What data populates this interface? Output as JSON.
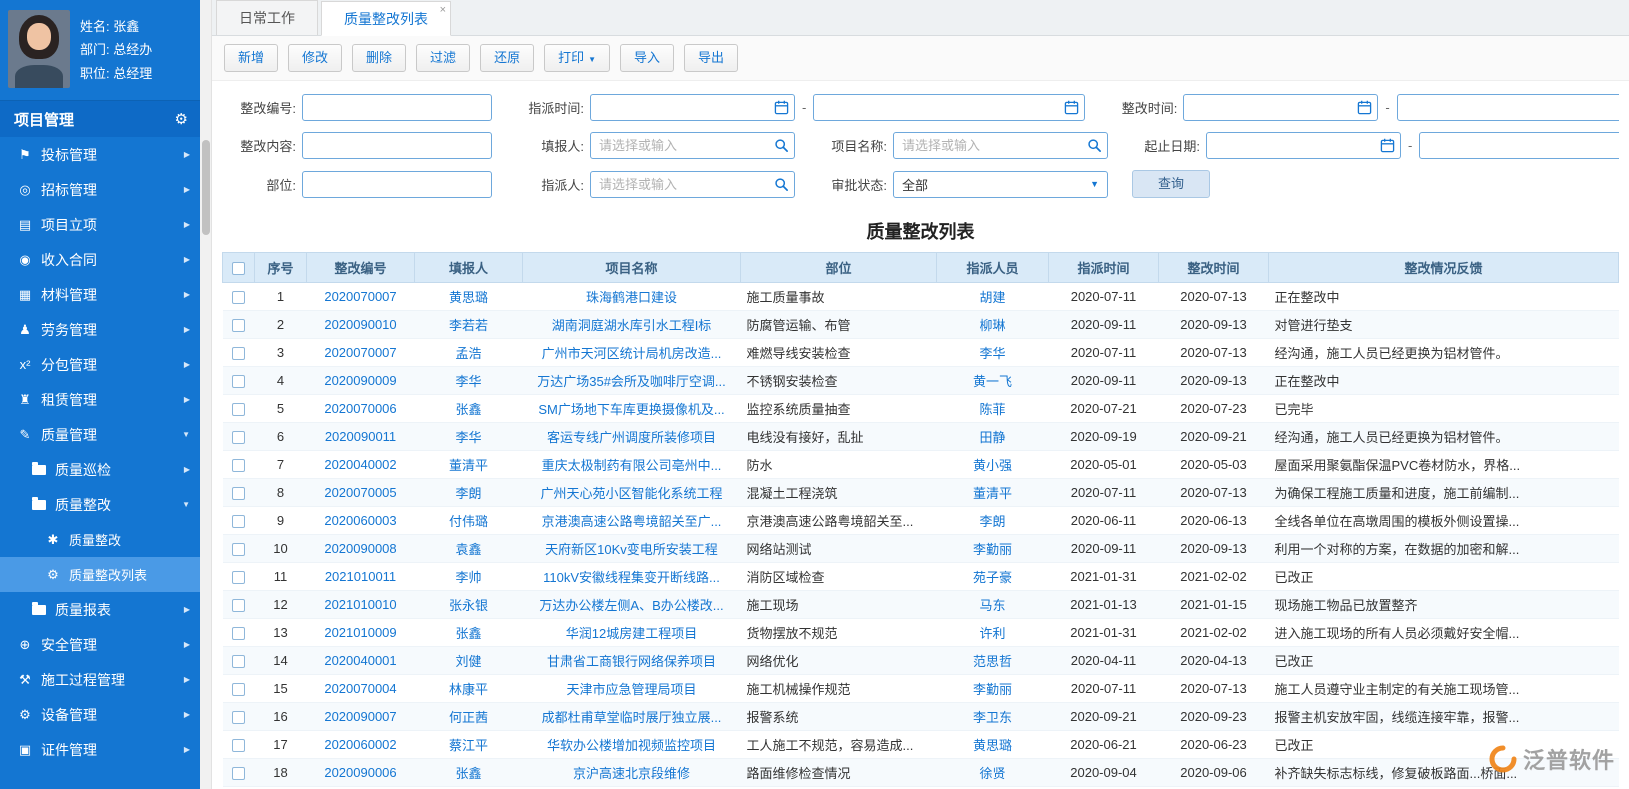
{
  "profile": {
    "name": "姓名: 张鑫",
    "department": "部门: 总经办",
    "position": "职位: 总经理"
  },
  "sidebar": {
    "header": "项目管理",
    "items": [
      {
        "label": "投标管理",
        "icon": "bid-management-icon",
        "glyph": "⚑",
        "arrow": "right",
        "level": 0
      },
      {
        "label": "招标管理",
        "icon": "tender-management-icon",
        "glyph": "◎",
        "arrow": "right",
        "level": 0
      },
      {
        "label": "项目立项",
        "icon": "project-initiation-icon",
        "glyph": "▤",
        "arrow": "right",
        "level": 0
      },
      {
        "label": "收入合同",
        "icon": "income-contract-icon",
        "glyph": "◉",
        "arrow": "right",
        "level": 0
      },
      {
        "label": "材料管理",
        "icon": "material-management-icon",
        "glyph": "▦",
        "arrow": "right",
        "level": 0
      },
      {
        "label": "劳务管理",
        "icon": "labor-management-icon",
        "glyph": "♟",
        "arrow": "right",
        "level": 0
      },
      {
        "label": "分包管理",
        "icon": "subcontract-management-icon",
        "glyph": "x²",
        "arrow": "right",
        "level": 0
      },
      {
        "label": "租赁管理",
        "icon": "lease-management-icon",
        "glyph": "♜",
        "arrow": "right",
        "level": 0
      },
      {
        "label": "质量管理",
        "icon": "quality-management-icon",
        "glyph": "✎",
        "arrow": "down",
        "level": 0
      },
      {
        "label": "质量巡检",
        "icon": "folder-icon",
        "glyph": "folder",
        "arrow": "right",
        "level": 1
      },
      {
        "label": "质量整改",
        "icon": "folder-icon",
        "glyph": "folder",
        "arrow": "down",
        "level": 1
      },
      {
        "label": "质量整改",
        "icon": "asterisk-icon",
        "glyph": "✱",
        "arrow": "none",
        "level": 2,
        "active": false
      },
      {
        "label": "质量整改列表",
        "icon": "gears-icon",
        "glyph": "⚙",
        "arrow": "none",
        "level": 2,
        "active": true
      },
      {
        "label": "质量报表",
        "icon": "folder-icon",
        "glyph": "folder",
        "arrow": "right",
        "level": 1
      },
      {
        "label": "安全管理",
        "icon": "safety-management-icon",
        "glyph": "⊕",
        "arrow": "right",
        "level": 0
      },
      {
        "label": "施工过程管理",
        "icon": "construction-process-icon",
        "glyph": "⚒",
        "arrow": "right",
        "level": 0
      },
      {
        "label": "设备管理",
        "icon": "equipment-management-icon",
        "glyph": "⚙",
        "arrow": "right",
        "level": 0
      },
      {
        "label": "证件管理",
        "icon": "certificate-management-icon",
        "glyph": "▣",
        "arrow": "right",
        "level": 0
      }
    ]
  },
  "tabs": [
    {
      "label": "日常工作",
      "active": false,
      "closable": false
    },
    {
      "label": "质量整改列表",
      "active": true,
      "closable": true
    }
  ],
  "toolbar": [
    {
      "label": "新增",
      "name": "add-button"
    },
    {
      "label": "修改",
      "name": "modify-button"
    },
    {
      "label": "删除",
      "name": "delete-button"
    },
    {
      "label": "过滤",
      "name": "filter-button"
    },
    {
      "label": "还原",
      "name": "restore-button"
    },
    {
      "label": "打印",
      "name": "print-button",
      "caret": true
    },
    {
      "label": "导入",
      "name": "import-button"
    },
    {
      "label": "导出",
      "name": "export-button"
    }
  ],
  "filters": {
    "rows": [
      [
        {
          "type": "text",
          "label": "整改编号:",
          "name": "rectify-no-input"
        },
        {
          "type": "daterange",
          "label": "指派时间:",
          "from": "assign-time-from",
          "to": "assign-time-to"
        },
        {
          "type": "daterange",
          "label": "整改时间:",
          "from": "rectify-time-from",
          "to": "rectify-time-to"
        }
      ],
      [
        {
          "type": "text",
          "label": "整改内容:",
          "name": "rectify-content-input"
        },
        {
          "type": "search",
          "label": "填报人:",
          "name": "reporter-input",
          "placeholder": "请选择或输入"
        },
        {
          "type": "search",
          "label": "项目名称:",
          "name": "project-name-input",
          "placeholder": "请选择或输入"
        },
        {
          "type": "daterange",
          "label": "起止日期:",
          "from": "start-date-from",
          "to": "start-date-to"
        }
      ],
      [
        {
          "type": "text",
          "label": "部位:",
          "name": "part-input"
        },
        {
          "type": "search",
          "label": "指派人:",
          "name": "assigner-input",
          "placeholder": "请选择或输入"
        },
        {
          "type": "select",
          "label": "审批状态:",
          "name": "approval-status-select",
          "value": "全部"
        },
        {
          "type": "button",
          "label": "查询",
          "name": "query-button"
        }
      ]
    ]
  },
  "table": {
    "title": "质量整改列表",
    "columns": [
      "序号",
      "整改编号",
      "填报人",
      "项目名称",
      "部位",
      "指派人员",
      "指派时间",
      "整改时间",
      "整改情况反馈"
    ],
    "rows": [
      {
        "seq": "1",
        "code": "2020070007",
        "reporter": "黄思璐",
        "project": "珠海鹤港口建设",
        "part": "施工质量事故",
        "assignee": "胡建",
        "assign_time": "2020-07-11",
        "rectify_time": "2020-07-13",
        "feedback": "正在整改中"
      },
      {
        "seq": "2",
        "code": "2020090010",
        "reporter": "李若若",
        "project": "湖南洞庭湖水库引水工程I标",
        "part": "防腐管运输、布管",
        "assignee": "柳琳",
        "assign_time": "2020-09-11",
        "rectify_time": "2020-09-13",
        "feedback": "对管进行垫支"
      },
      {
        "seq": "3",
        "code": "2020070007",
        "reporter": "孟浩",
        "project": "广州市天河区统计局机房改造...",
        "part": "难燃导线安装检查",
        "assignee": "李华",
        "assign_time": "2020-07-11",
        "rectify_time": "2020-07-13",
        "feedback": "经沟通，施工人员已经更换为铝材管件。"
      },
      {
        "seq": "4",
        "code": "2020090009",
        "reporter": "李华",
        "project": "万达广场35#会所及咖啡厅空调...",
        "part": "不锈钢安装检查",
        "assignee": "黄一飞",
        "assign_time": "2020-09-11",
        "rectify_time": "2020-09-13",
        "feedback": "正在整改中"
      },
      {
        "seq": "5",
        "code": "2020070006",
        "reporter": "张鑫",
        "project": "SM广场地下车库更换摄像机及...",
        "part": "监控系统质量抽查",
        "assignee": "陈菲",
        "assign_time": "2020-07-21",
        "rectify_time": "2020-07-23",
        "feedback": "已完毕"
      },
      {
        "seq": "6",
        "code": "2020090011",
        "reporter": "李华",
        "project": "客运专线广州调度所装修项目",
        "part": "电线没有接好，乱扯",
        "assignee": "田静",
        "assign_time": "2020-09-19",
        "rectify_time": "2020-09-21",
        "feedback": "经沟通，施工人员已经更换为铝材管件。"
      },
      {
        "seq": "7",
        "code": "2020040002",
        "reporter": "董清平",
        "project": "重庆太极制药有限公司亳州中...",
        "part": "防水",
        "assignee": "黄小强",
        "assign_time": "2020-05-01",
        "rectify_time": "2020-05-03",
        "feedback": "屋面采用聚氨酯保温PVC卷材防水，界格..."
      },
      {
        "seq": "8",
        "code": "2020070005",
        "reporter": "李朗",
        "project": "广州天心苑小区智能化系统工程",
        "part": "混凝土工程浇筑",
        "assignee": "董清平",
        "assign_time": "2020-07-11",
        "rectify_time": "2020-07-13",
        "feedback": "为确保工程施工质量和进度，施工前编制..."
      },
      {
        "seq": "9",
        "code": "2020060003",
        "reporter": "付伟璐",
        "project": "京港澳高速公路粤境韶关至广...",
        "part": "京港澳高速公路粤境韶关至...",
        "assignee": "李朗",
        "assign_time": "2020-06-11",
        "rectify_time": "2020-06-13",
        "feedback": "全线各单位在高墩周围的模板外侧设置操..."
      },
      {
        "seq": "10",
        "code": "2020090008",
        "reporter": "袁鑫",
        "project": "天府新区10Kv变电所安装工程",
        "part": "网络站测试",
        "assignee": "李勤丽",
        "assign_time": "2020-09-11",
        "rectify_time": "2020-09-13",
        "feedback": "利用一个对称的方案，在数据的加密和解..."
      },
      {
        "seq": "11",
        "code": "2021010011",
        "reporter": "李帅",
        "project": "110kV安徽线程集变开断线路...",
        "part": "消防区域检查",
        "assignee": "苑子豪",
        "assign_time": "2021-01-31",
        "rectify_time": "2021-02-02",
        "feedback": "已改正"
      },
      {
        "seq": "12",
        "code": "2021010010",
        "reporter": "张永银",
        "project": "万达办公楼左侧A、B办公楼改...",
        "part": "施工现场",
        "assignee": "马东",
        "assign_time": "2021-01-13",
        "rectify_time": "2021-01-15",
        "feedback": "现场施工物品已放置整齐"
      },
      {
        "seq": "13",
        "code": "2021010009",
        "reporter": "张鑫",
        "project": "华润12城房建工程项目",
        "part": "货物摆放不规范",
        "assignee": "许利",
        "assign_time": "2021-01-31",
        "rectify_time": "2021-02-02",
        "feedback": "进入施工现场的所有人员必须戴好安全帽..."
      },
      {
        "seq": "14",
        "code": "2020040001",
        "reporter": "刘健",
        "project": "甘肃省工商银行网络保养项目",
        "part": "网络优化",
        "assignee": "范思哲",
        "assign_time": "2020-04-11",
        "rectify_time": "2020-04-13",
        "feedback": "已改正"
      },
      {
        "seq": "15",
        "code": "2020070004",
        "reporter": "林康平",
        "project": "天津市应急管理局项目",
        "part": "施工机械操作规范",
        "assignee": "李勤丽",
        "assign_time": "2020-07-11",
        "rectify_time": "2020-07-13",
        "feedback": "施工人员遵守业主制定的有关施工现场管..."
      },
      {
        "seq": "16",
        "code": "2020090007",
        "reporter": "何正茜",
        "project": "成都杜甫草堂临时展厅独立展...",
        "part": "报警系统",
        "assignee": "李卫东",
        "assign_time": "2020-09-21",
        "rectify_time": "2020-09-23",
        "feedback": "报警主机安放牢固，线缆连接牢靠，报警..."
      },
      {
        "seq": "17",
        "code": "2020060002",
        "reporter": "蔡江平",
        "project": "华软办公楼增加视频监控项目",
        "part": "工人施工不规范，容易造成...",
        "assignee": "黄思璐",
        "assign_time": "2020-06-21",
        "rectify_time": "2020-06-23",
        "feedback": "已改正"
      },
      {
        "seq": "18",
        "code": "2020090006",
        "reporter": "张鑫",
        "project": "京沪高速北京段维修",
        "part": "路面维修检查情况",
        "assignee": "徐贤",
        "assign_time": "2020-09-04",
        "rectify_time": "2020-09-06",
        "feedback": "补齐缺失标志标线，修复破板路面...桥面..."
      }
    ]
  },
  "watermark": {
    "text": "泛普软件"
  }
}
